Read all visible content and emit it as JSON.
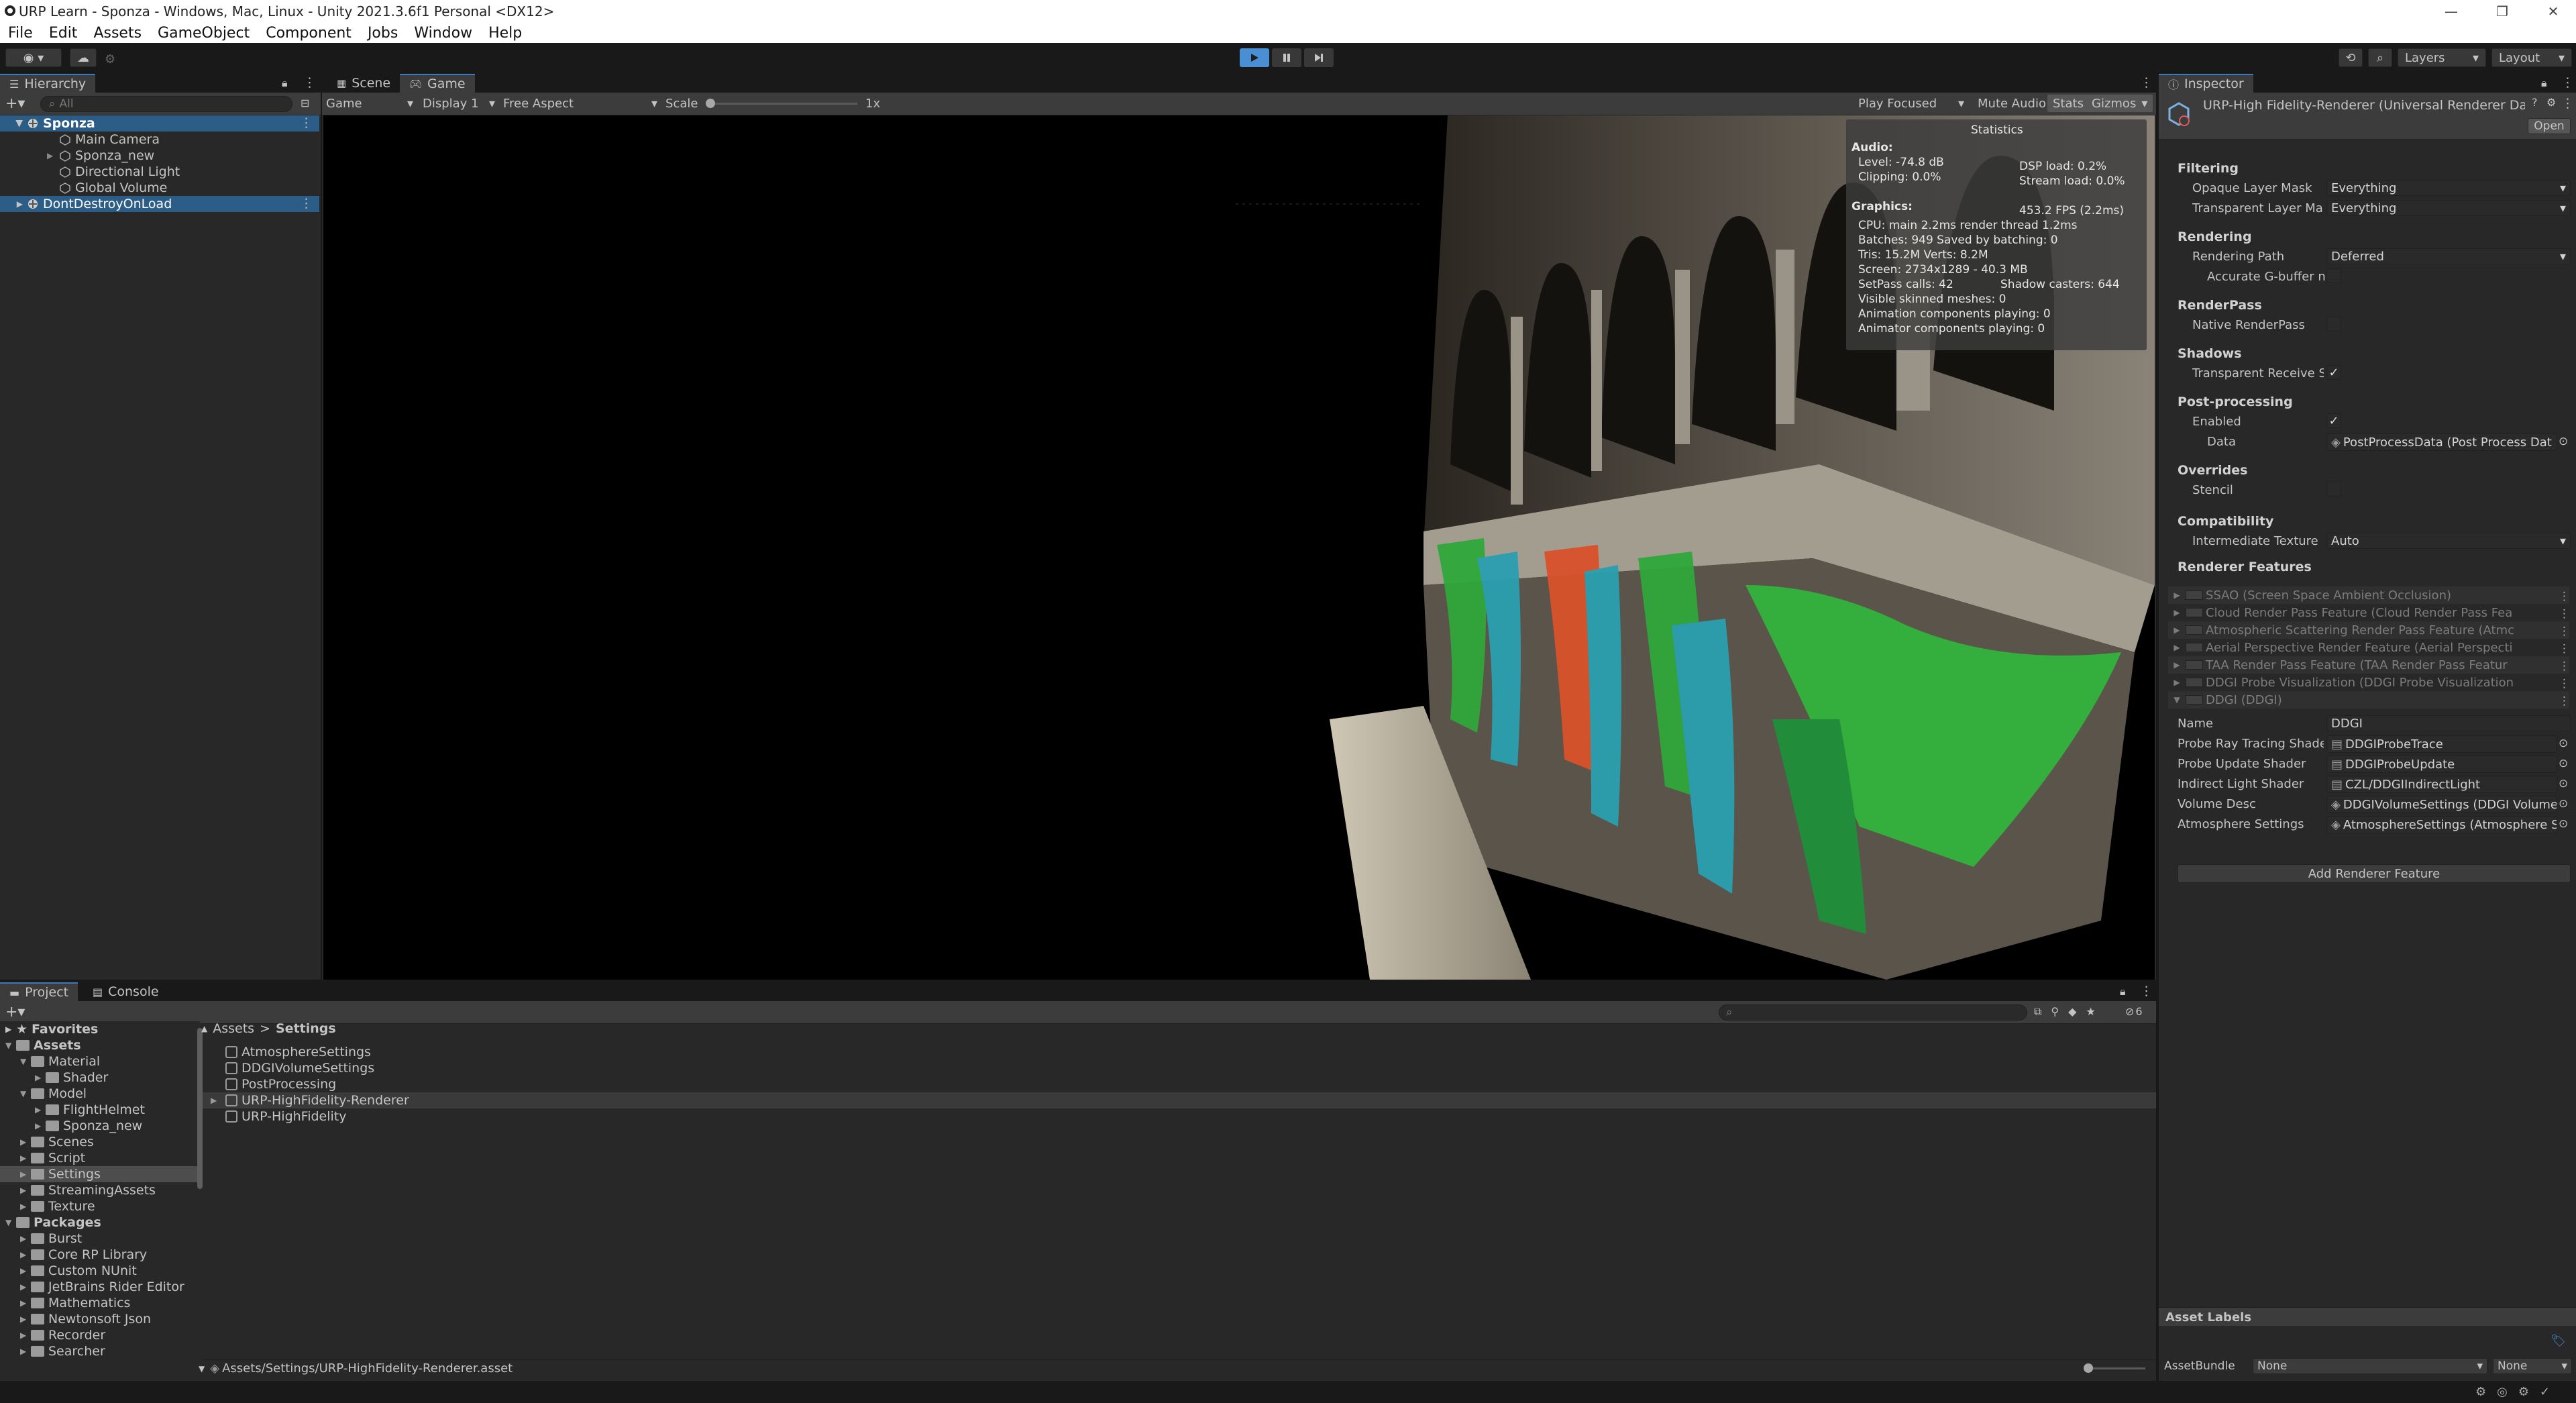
{
  "window": {
    "title": "URP Learn - Sponza - Windows, Mac, Linux - Unity 2021.3.6f1 Personal <DX12>"
  },
  "menu": [
    "File",
    "Edit",
    "Assets",
    "GameObject",
    "Component",
    "Jobs",
    "Window",
    "Help"
  ],
  "toolbar": {
    "layers_label": "Layers",
    "layout_label": "Layout"
  },
  "hierarchy": {
    "tab": "Hierarchy",
    "search_placeholder": "All",
    "items": [
      {
        "label": "Sponza",
        "depth": 0,
        "bold": true
      },
      {
        "label": "Main Camera",
        "depth": 1
      },
      {
        "label": "Sponza_new",
        "depth": 1
      },
      {
        "label": "Directional Light",
        "depth": 1
      },
      {
        "label": "Global Volume",
        "depth": 1
      },
      {
        "label": "DontDestroyOnLoad",
        "depth": 0
      }
    ]
  },
  "center": {
    "tabs": [
      "Scene",
      "Game"
    ],
    "game_dropdown": "Game",
    "display": "Display 1",
    "aspect": "Free Aspect",
    "scale_label": "Scale",
    "scale_value": "1x",
    "scale_fraction": 0.0,
    "play_focused": "Play Focused",
    "mute_audio": "Mute Audio",
    "stats": "Stats",
    "gizmos": "Gizmos"
  },
  "statistics": {
    "title": "Statistics",
    "audio_header": "Audio:",
    "level": "Level: -74.8 dB",
    "clipping": "Clipping: 0.0%",
    "dsp_load": "DSP load: 0.2%",
    "stream_load": "Stream load: 0.0%",
    "graphics_header": "Graphics:",
    "fps": "453.2 FPS (2.2ms)",
    "cpu": "CPU: main 2.2ms  render thread 1.2ms",
    "batches": "Batches: 949   Saved by batching: 0",
    "tris": "Tris: 15.2M     Verts: 8.2M",
    "screen": "Screen: 2734x1289 - 40.3 MB",
    "setpass": "SetPass calls: 42",
    "shadow_casters": "Shadow casters: 644",
    "skinned": "Visible skinned meshes: 0",
    "anim_components": "Animation components playing: 0",
    "animator_components": "Animator components playing: 0"
  },
  "inspector": {
    "tab": "Inspector",
    "object_title": "URP-High Fidelity-Renderer (Universal Renderer Dat",
    "open_button": "Open",
    "sections": {
      "filtering": "Filtering",
      "rendering": "Rendering",
      "renderpass": "RenderPass",
      "shadows": "Shadows",
      "postprocessing": "Post-processing",
      "overrides": "Overrides",
      "compatibility": "Compatibility",
      "renderer_features": "Renderer Features"
    },
    "fields": {
      "opaque_layer_mask_label": "Opaque Layer Mask",
      "opaque_layer_mask_value": "Everything",
      "transparent_layer_mask_label": "Transparent Layer Ma",
      "transparent_layer_mask_value": "Everything",
      "rendering_path_label": "Rendering Path",
      "rendering_path_value": "Deferred",
      "accurate_gbuffer_label": "Accurate G-buffer n",
      "native_renderpass_label": "Native RenderPass",
      "transparent_receive_label": "Transparent Receive S",
      "pp_enabled_label": "Enabled",
      "pp_data_label": "Data",
      "pp_data_value": "PostProcessData (Post Process Dat",
      "stencil_label": "Stencil",
      "intermediate_texture_label": "Intermediate Texture",
      "intermediate_texture_value": "Auto"
    },
    "features": [
      "SSAO (Screen Space Ambient Occlusion)",
      "Cloud Render Pass Feature (Cloud Render Pass Fea",
      "Atmospheric Scattering Render Pass Feature (Atmc",
      "Aerial Perspective Render Feature (Aerial Perspecti",
      "TAA Render Pass Feature (TAA Render Pass Featur",
      "DDGI Probe Visualization (DDGI Probe Visualization",
      "DDGI (DDGI)"
    ],
    "ddgi": {
      "name_label": "Name",
      "name_value": "DDGI",
      "rows": [
        {
          "label": "Probe Ray Tracing Shade",
          "value": "DDGIProbeTrace"
        },
        {
          "label": "Probe Update Shader",
          "value": "DDGIProbeUpdate"
        },
        {
          "label": "Indirect Light Shader",
          "value": "CZL/DDGIIndirectLight"
        },
        {
          "label": "Volume Desc",
          "value": "DDGIVolumeSettings (DDGI Volume"
        },
        {
          "label": "Atmosphere Settings",
          "value": "AtmosphereSettings (Atmosphere Se"
        }
      ]
    },
    "add_feature_button": "Add Renderer Feature",
    "asset_labels": "Asset Labels",
    "asset_bundle_label": "AssetBundle",
    "asset_bundle_value": "None",
    "asset_bundle_variant": "None"
  },
  "project": {
    "tabs": [
      "Project",
      "Console"
    ],
    "favorites": "Favorites",
    "tree": [
      {
        "label": "Assets",
        "depth": 0,
        "bold": true
      },
      {
        "label": "Material",
        "depth": 1
      },
      {
        "label": "Shader",
        "depth": 2
      },
      {
        "label": "Model",
        "depth": 1
      },
      {
        "label": "FlightHelmet",
        "depth": 2
      },
      {
        "label": "Sponza_new",
        "depth": 2
      },
      {
        "label": "Scenes",
        "depth": 1
      },
      {
        "label": "Script",
        "depth": 1
      },
      {
        "label": "Settings",
        "depth": 1,
        "selected": true
      },
      {
        "label": "StreamingAssets",
        "depth": 1
      },
      {
        "label": "Texture",
        "depth": 1
      },
      {
        "label": "Packages",
        "depth": 0,
        "bold": true
      },
      {
        "label": "Burst",
        "depth": 1
      },
      {
        "label": "Core RP Library",
        "depth": 1
      },
      {
        "label": "Custom NUnit",
        "depth": 1
      },
      {
        "label": "JetBrains Rider Editor",
        "depth": 1
      },
      {
        "label": "Mathematics",
        "depth": 1
      },
      {
        "label": "Newtonsoft Json",
        "depth": 1
      },
      {
        "label": "Recorder",
        "depth": 1
      },
      {
        "label": "Searcher",
        "depth": 1
      }
    ],
    "breadcrumb_root": "Assets",
    "breadcrumb_sep": ">",
    "breadcrumb_current": "Settings",
    "assets": [
      {
        "label": "AtmosphereSettings"
      },
      {
        "label": "DDGIVolumeSettings"
      },
      {
        "label": "PostProcessing"
      },
      {
        "label": "URP-HighFidelity-Renderer",
        "selected": true
      },
      {
        "label": "URP-HighFidelity"
      }
    ],
    "status_path": "Assets/Settings/URP-HighFidelity-Renderer.asset",
    "hidden_count": "6"
  },
  "colors": {
    "accent": "#3a79bb",
    "panel": "#282828",
    "play_active": "#4a8fd4"
  }
}
